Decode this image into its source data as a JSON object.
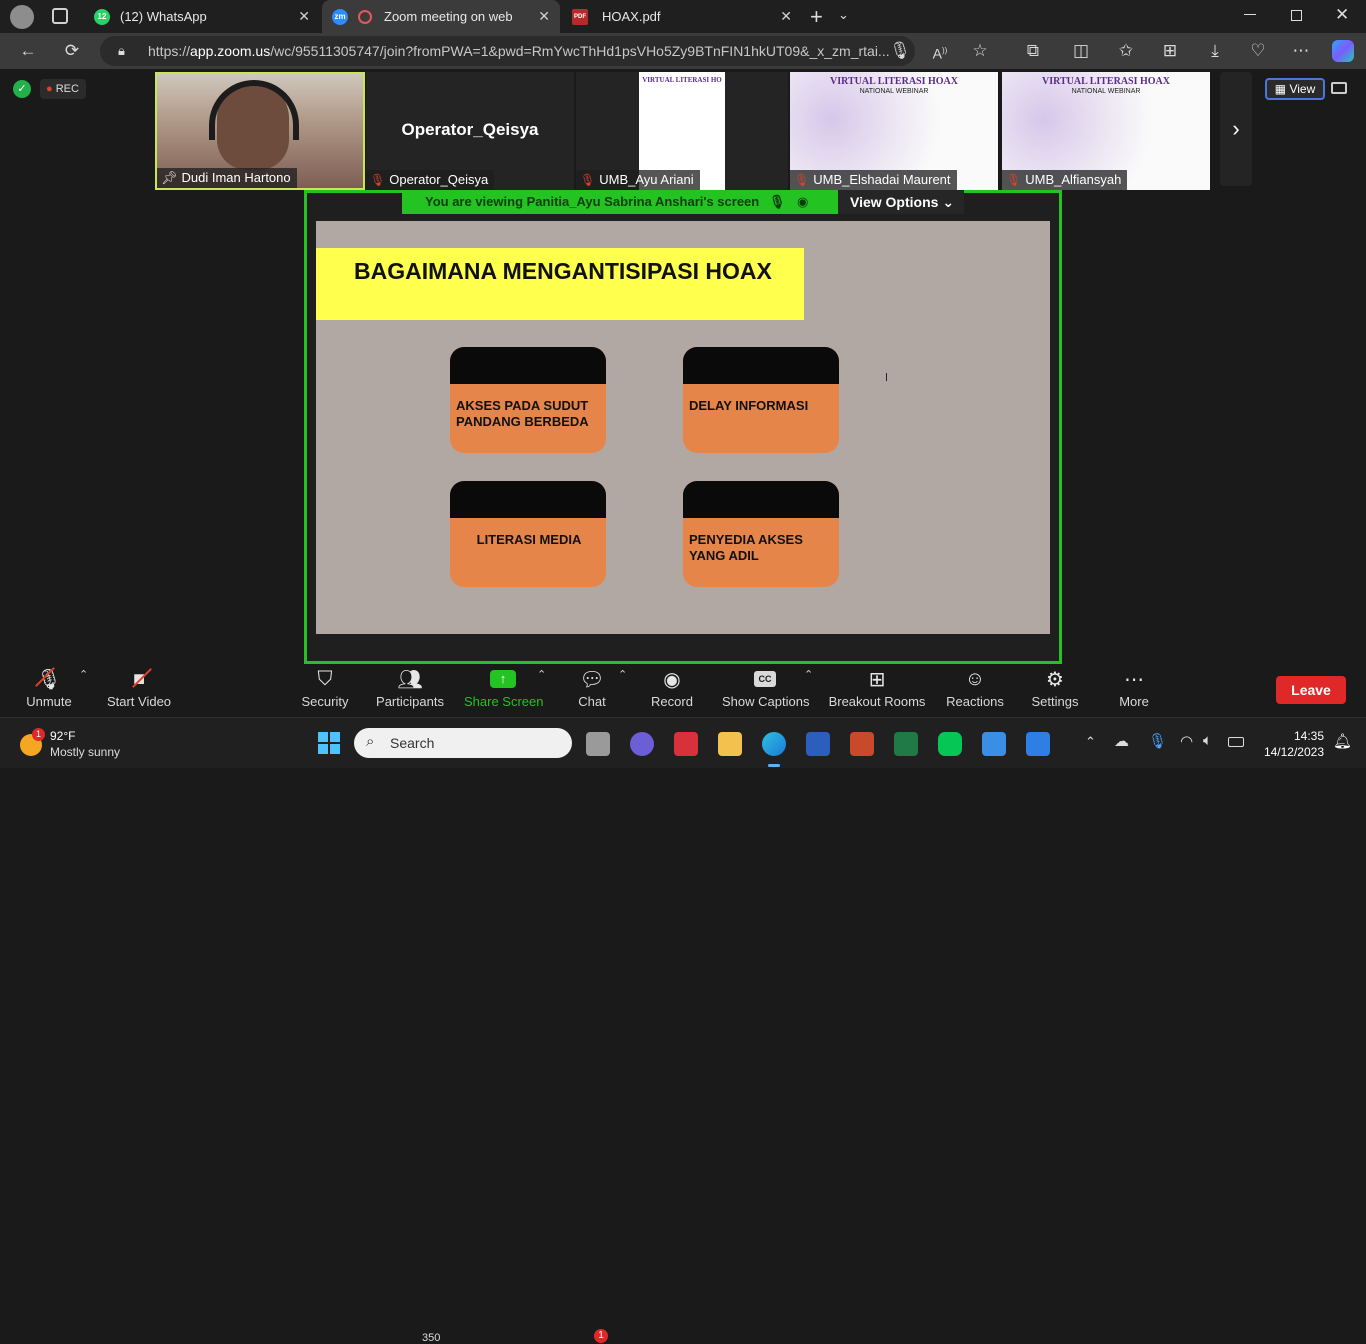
{
  "browser": {
    "tabs": [
      {
        "label": "(12) WhatsApp",
        "badge": "12"
      },
      {
        "label": "Zoom meeting on web"
      },
      {
        "label": "HOAX.pdf"
      }
    ],
    "url_prefix": "https://",
    "url_domain": "app.zoom.us",
    "url_rest": "/wc/95511305747/join?fromPWA=1&pwd=RmYwcThHd1psVHo5Zy9BTnFIN1hkUT09&_x_zm_rtai..."
  },
  "meeting": {
    "rec_label": "REC",
    "view_button": "View",
    "participants": [
      {
        "name": "Dudi Iman Hartono"
      },
      {
        "name": "Operator_Qeisya",
        "center_label": "Operator_Qeisya"
      },
      {
        "name": "UMB_Ayu Ariani",
        "slide_title": "VIRTUAL LITERASI HO"
      },
      {
        "name": "UMB_Elshadai Maurent",
        "slide_title": "VIRTUAL LITERASI HOAX",
        "slide_sub": "NATIONAL WEBINAR"
      },
      {
        "name": "UMB_Alfiansyah",
        "slide_title": "VIRTUAL LITERASI HOAX",
        "slide_sub": "NATIONAL WEBINAR"
      }
    ],
    "viewing_banner": "You are viewing  Panitia_Ayu Sabrina Anshari's screen",
    "view_options": "View Options"
  },
  "slide": {
    "title": "BAGAIMANA MENGANTISIPASI HOAX",
    "cards": [
      {
        "label": "AKSES PADA SUDUT PANDANG BERBEDA"
      },
      {
        "label": "DELAY INFORMASI"
      },
      {
        "label": "LITERASI MEDIA"
      },
      {
        "label": "PENYEDIA AKSES YANG ADIL"
      }
    ]
  },
  "toolbar": {
    "unmute": "Unmute",
    "start_video": "Start Video",
    "security": "Security",
    "participants": "Participants",
    "participants_count": "350",
    "share_screen": "Share Screen",
    "chat": "Chat",
    "chat_badge": "1",
    "record": "Record",
    "show_captions": "Show Captions",
    "breakout_rooms": "Breakout Rooms",
    "reactions": "Reactions",
    "settings": "Settings",
    "more": "More",
    "leave": "Leave"
  },
  "taskbar": {
    "weather_temp": "92°F",
    "weather_desc": "Mostly sunny",
    "weather_badge": "1",
    "search_placeholder": "Search",
    "time": "14:35",
    "date": "14/12/2023"
  },
  "colors": {
    "share_green": "#23c322",
    "leave_red": "#e02828",
    "slide_yellow": "#ffff4d",
    "card_orange": "#e6854a"
  }
}
